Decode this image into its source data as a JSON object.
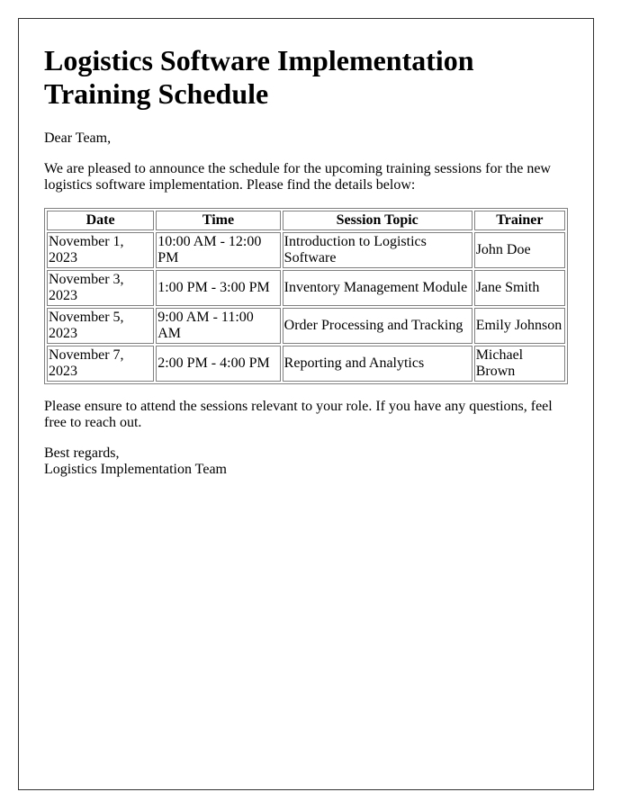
{
  "title": "Logistics Software Implementation Training Schedule",
  "greeting": "Dear Team,",
  "intro": "We are pleased to announce the schedule for the upcoming training sessions for the new logistics software implementation. Please find the details below:",
  "table": {
    "headers": [
      "Date",
      "Time",
      "Session Topic",
      "Trainer"
    ],
    "rows": [
      [
        "November 1, 2023",
        "10:00 AM - 12:00 PM",
        "Introduction to Logistics Software",
        "John Doe"
      ],
      [
        "November 3, 2023",
        "1:00 PM - 3:00 PM",
        "Inventory Management Module",
        "Jane Smith"
      ],
      [
        "November 5, 2023",
        "9:00 AM - 11:00 AM",
        "Order Processing and Tracking",
        "Emily Johnson"
      ],
      [
        "November 7, 2023",
        "2:00 PM - 4:00 PM",
        "Reporting and Analytics",
        "Michael Brown"
      ]
    ]
  },
  "closing_note": "Please ensure to attend the sessions relevant to your role. If you have any questions, feel free to reach out.",
  "signoff": "Best regards,",
  "signature": "Logistics Implementation Team"
}
